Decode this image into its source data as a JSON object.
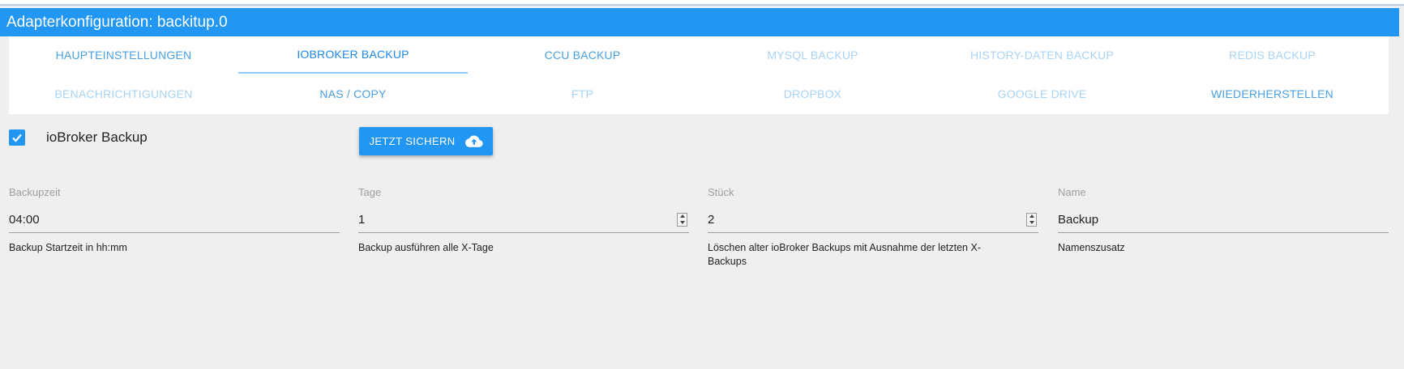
{
  "header": {
    "title": "Adapterkonfiguration: backitup.0"
  },
  "tabs": [
    {
      "label": "HAUPTEINSTELLUNGEN",
      "color": "#4a9fe0"
    },
    {
      "label": "IOBROKER BACKUP",
      "color": "#1e88e5"
    },
    {
      "label": "CCU BACKUP",
      "color": "#4a9fe0"
    },
    {
      "label": "MYSQL BACKUP",
      "color": "#a9d3f5"
    },
    {
      "label": "HISTORY-DATEN BACKUP",
      "color": "#a9d3f5"
    },
    {
      "label": "REDIS BACKUP",
      "color": "#a9d3f5"
    },
    {
      "label": "BENACHRICHTIGUNGEN",
      "color": "#a9d3f5"
    },
    {
      "label": "NAS / COPY",
      "color": "#4a9fe0"
    },
    {
      "label": "FTP",
      "color": "#a9d3f5"
    },
    {
      "label": "DROPBOX",
      "color": "#a9d3f5"
    },
    {
      "label": "GOOGLE DRIVE",
      "color": "#a9d3f5"
    },
    {
      "label": "WIEDERHERSTELLEN",
      "color": "#4a9fe0"
    }
  ],
  "active_tab": "IOBROKER BACKUP",
  "enable": {
    "label": "ioBroker Backup",
    "checked": true
  },
  "action_button": {
    "label": "JETZT SICHERN",
    "icon": "cloud-upload-icon"
  },
  "fields": [
    {
      "label": "Backupzeit",
      "value": "04:00",
      "help": "Backup Startzeit in hh:mm",
      "spinner": false
    },
    {
      "label": "Tage",
      "value": "1",
      "help": "Backup ausführen alle X-Tage",
      "spinner": true
    },
    {
      "label": "Stück",
      "value": "2",
      "help": "Löschen alter ioBroker Backups mit Ausnahme der letzten X-Backups",
      "spinner": true
    },
    {
      "label": "Name",
      "value": "Backup",
      "help": "Namenszusatz",
      "spinner": false
    }
  ],
  "colors": {
    "accent": "#2196f3",
    "background": "#efefef"
  }
}
